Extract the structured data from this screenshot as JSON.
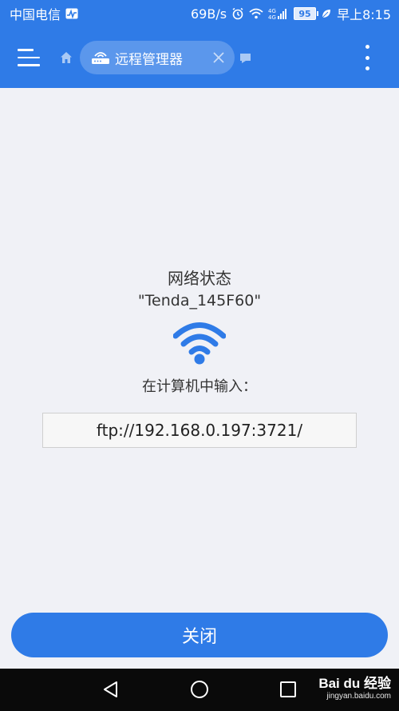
{
  "status_bar": {
    "carrier": "中国电信",
    "speed": "69B/s",
    "network_type": "4G",
    "battery": "95",
    "time": "早上8:15",
    "colors": {
      "background": "#2f7be7",
      "text": "#ffffff"
    }
  },
  "toolbar": {
    "tab": {
      "label": "远程管理器",
      "icon": "router-icon"
    },
    "icons": [
      "menu-icon",
      "home-icon",
      "router-icon",
      "close-icon",
      "tab-overview-icon",
      "more-vert-icon"
    ]
  },
  "main": {
    "network_status_label": "网络状态",
    "ssid": "\"Tenda_145F60\"",
    "instruction": "在计算机中输入：",
    "ftp_address": "ftp://192.168.0.197:3721/",
    "close_button_label": "关闭"
  },
  "nav_bar": {
    "icons": [
      "back-icon",
      "home-circle-icon",
      "recents-icon"
    ]
  },
  "watermark": {
    "logo": "Bai du 经验",
    "url": "jingyan.baidu.com"
  },
  "colors": {
    "accent": "#2f7be7",
    "page_background": "#f0f1f6",
    "text": "#333333"
  }
}
